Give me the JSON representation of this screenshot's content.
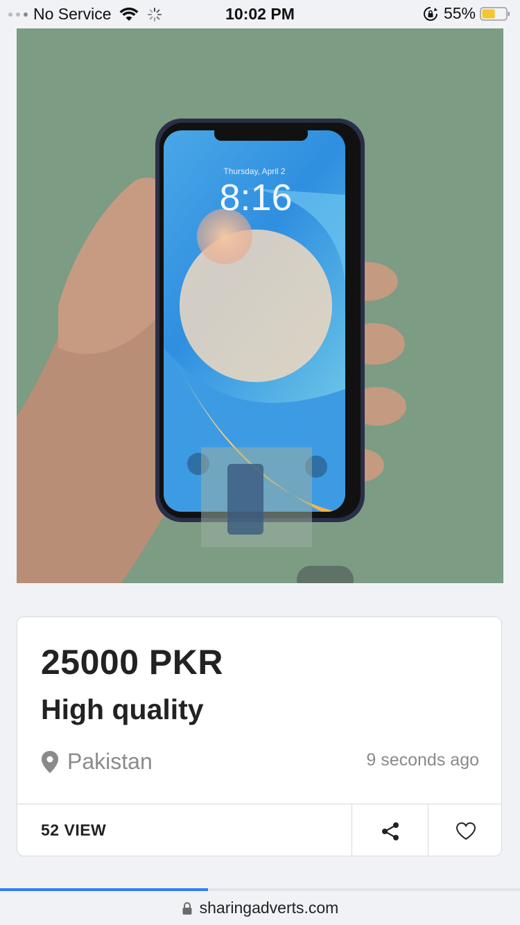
{
  "status_bar": {
    "carrier": "No Service",
    "time": "10:02 PM",
    "battery": "55%",
    "battery_level": 0.55,
    "icons": [
      "signal-dots-icon",
      "wifi-icon",
      "loading-spinner-icon",
      "rotation-lock-icon",
      "battery-icon"
    ]
  },
  "gallery": {
    "phone_screen": {
      "date": "Thursday, April 2",
      "time": "8:16"
    },
    "pager": "dots"
  },
  "listing": {
    "price": "25000 PKR",
    "title": "High quality",
    "location": "Pakistan",
    "posted": "9 seconds ago",
    "views": "52 VIEW",
    "icons": [
      "location-pin-icon",
      "share-icon",
      "heart-icon"
    ]
  },
  "browser": {
    "url": "sharingadverts.com",
    "load_progress": 0.4,
    "colors": {
      "progress": "#2f7cf6",
      "background": "#f1f2f6"
    }
  }
}
